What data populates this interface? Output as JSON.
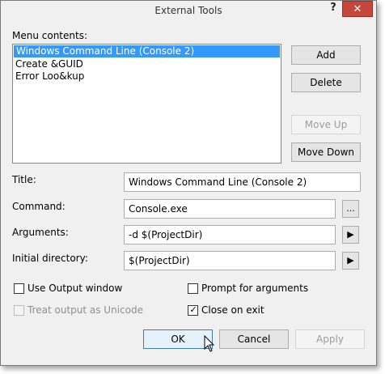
{
  "window": {
    "title": "External Tools",
    "help_label": "?",
    "close_label": "✕"
  },
  "menu_contents": {
    "label": "Menu contents:",
    "items": [
      {
        "label": "Windows Command Line (Console 2)",
        "selected": true
      },
      {
        "label": "Create &GUID",
        "selected": false
      },
      {
        "label": "Error Loo&kup",
        "selected": false
      }
    ]
  },
  "side_buttons": {
    "add": "Add",
    "delete": "Delete",
    "move_up": "Move Up",
    "move_down": "Move Down"
  },
  "fields": {
    "title_label": "Title:",
    "title_value": "Windows Command Line (Console 2)",
    "command_label": "Command:",
    "command_value": "Console.exe",
    "browse_label": "...",
    "arguments_label": "Arguments:",
    "arguments_value": "-d $(ProjectDir)",
    "initial_dir_label": "Initial directory:",
    "initial_dir_value": "$(ProjectDir)",
    "arrow_label": "▶"
  },
  "options": {
    "use_output_window": {
      "label": "Use Output window",
      "checked": false
    },
    "prompt_for_arguments": {
      "label": "Prompt for arguments",
      "checked": false
    },
    "treat_output_unicode": {
      "label": "Treat output as Unicode",
      "checked": false
    },
    "close_on_exit": {
      "label": "Close on exit",
      "checked": true
    }
  },
  "dialog_buttons": {
    "ok": "OK",
    "cancel": "Cancel",
    "apply": "Apply"
  },
  "colors": {
    "selection": "#3399ff",
    "close_button": "#c7463a",
    "dialog_bg": "#f0f0f0"
  }
}
